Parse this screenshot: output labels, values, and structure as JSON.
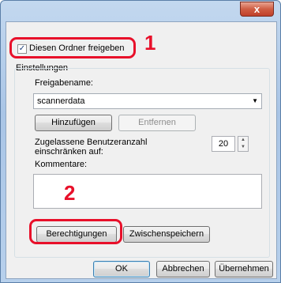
{
  "window": {
    "close_glyph": "x"
  },
  "share": {
    "share_checkbox_label": "Diesen Ordner freigeben",
    "share_checked": true,
    "settings_label": "Einstellungen",
    "share_name_label": "Freigabename:",
    "share_name_value": "scannerdata",
    "add_label": "Hinzufügen",
    "remove_label": "Entfernen",
    "user_limit_label": "Zugelassene Benutzeranzahl einschränken auf:",
    "user_limit_value": "20",
    "comments_label": "Kommentare:",
    "permissions_label": "Berechtigungen",
    "caching_label": "Zwischenspeichern"
  },
  "buttons": {
    "ok": "OK",
    "cancel": "Abbrechen",
    "apply": "Übernehmen"
  },
  "callouts": {
    "step1": "1",
    "step2": "2"
  },
  "colors": {
    "highlight": "#e8102a"
  }
}
